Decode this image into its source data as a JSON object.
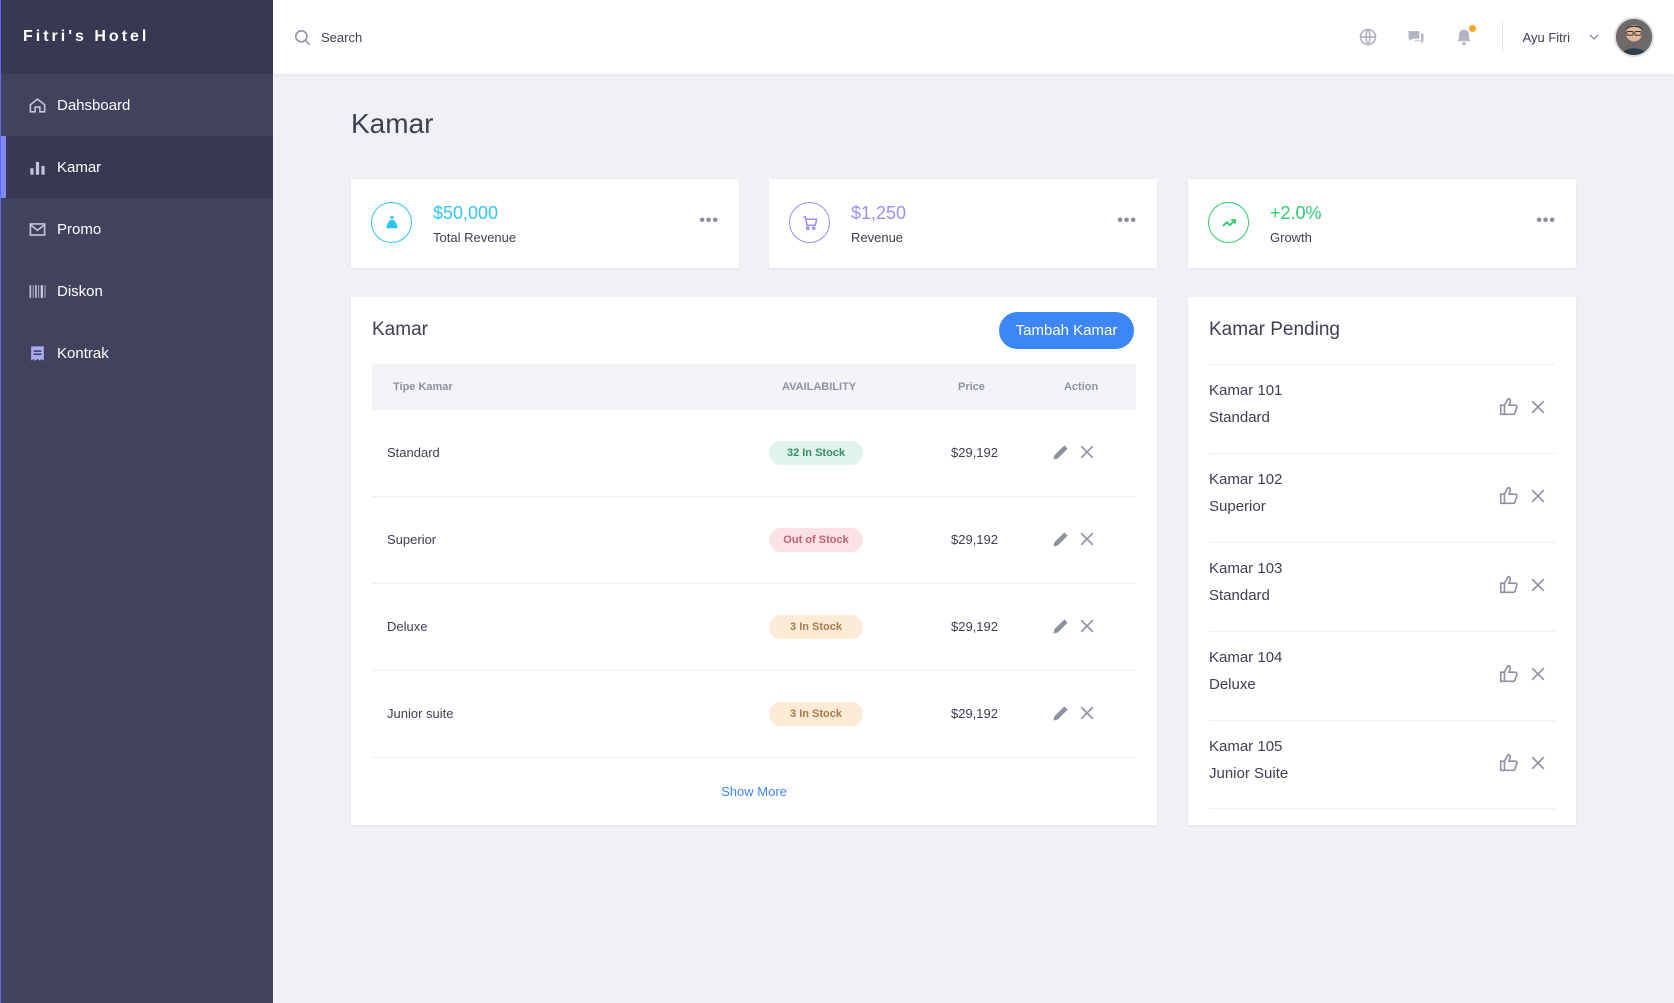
{
  "brand": "Fitri's Hotel",
  "sidebar": {
    "items": [
      {
        "label": "Dahsboard",
        "icon": "home-icon"
      },
      {
        "label": "Kamar",
        "icon": "bar-chart-icon"
      },
      {
        "label": "Promo",
        "icon": "mail-icon"
      },
      {
        "label": "Diskon",
        "icon": "barcode-icon"
      },
      {
        "label": "Kontrak",
        "icon": "receipt-icon"
      }
    ],
    "active_index": 1
  },
  "header": {
    "search_placeholder": "Search",
    "user_name": "Ayu Fitri",
    "icons": [
      "globe-icon",
      "chat-icon",
      "bell-icon",
      "chevron-down-icon"
    ]
  },
  "page_title": "Kamar",
  "stats": [
    {
      "value": "$50,000",
      "label": "Total Revenue",
      "icon": "money-bag-icon",
      "color": "#2fc6f6"
    },
    {
      "value": "$1,250",
      "label": "Revenue",
      "icon": "cart-icon",
      "color": "#a08cf6"
    },
    {
      "value": "+2.0%",
      "label": "Growth",
      "icon": "trending-up-icon",
      "color": "#2ecc71"
    }
  ],
  "rooms_card": {
    "title": "Kamar",
    "add_button": "Tambah Kamar",
    "columns": [
      "Tipe Kamar",
      "AVAILABILITY",
      "Price",
      "Action"
    ],
    "rows": [
      {
        "name": "Standard",
        "availability": "32 In Stock",
        "status": "in",
        "price": "$29,192"
      },
      {
        "name": "Superior",
        "availability": "Out of Stock",
        "status": "out",
        "price": "$29,192"
      },
      {
        "name": "Deluxe",
        "availability": "3 In Stock",
        "status": "low",
        "price": "$29,192"
      },
      {
        "name": "Junior suite",
        "availability": "3 In Stock",
        "status": "low",
        "price": "$29,192"
      }
    ],
    "show_more": "Show More"
  },
  "pending_card": {
    "title": "Kamar Pending",
    "items": [
      {
        "room": "Kamar 101",
        "type": "Standard"
      },
      {
        "room": "Kamar 102",
        "type": "Superior"
      },
      {
        "room": "Kamar 103",
        "type": "Standard"
      },
      {
        "room": "Kamar 104",
        "type": "Deluxe"
      },
      {
        "room": "Kamar 105",
        "type": "Junior Suite"
      }
    ]
  },
  "colors": {
    "accent": "#3d86f5",
    "sidebar": "#42425f",
    "badge_in_bg": "#dff5ec",
    "badge_in_fg": "#3a8a6a",
    "badge_out_bg": "#fde1e4",
    "badge_out_fg": "#c0626f",
    "badge_low_bg": "#fdebd6",
    "badge_low_fg": "#a87a4a"
  }
}
